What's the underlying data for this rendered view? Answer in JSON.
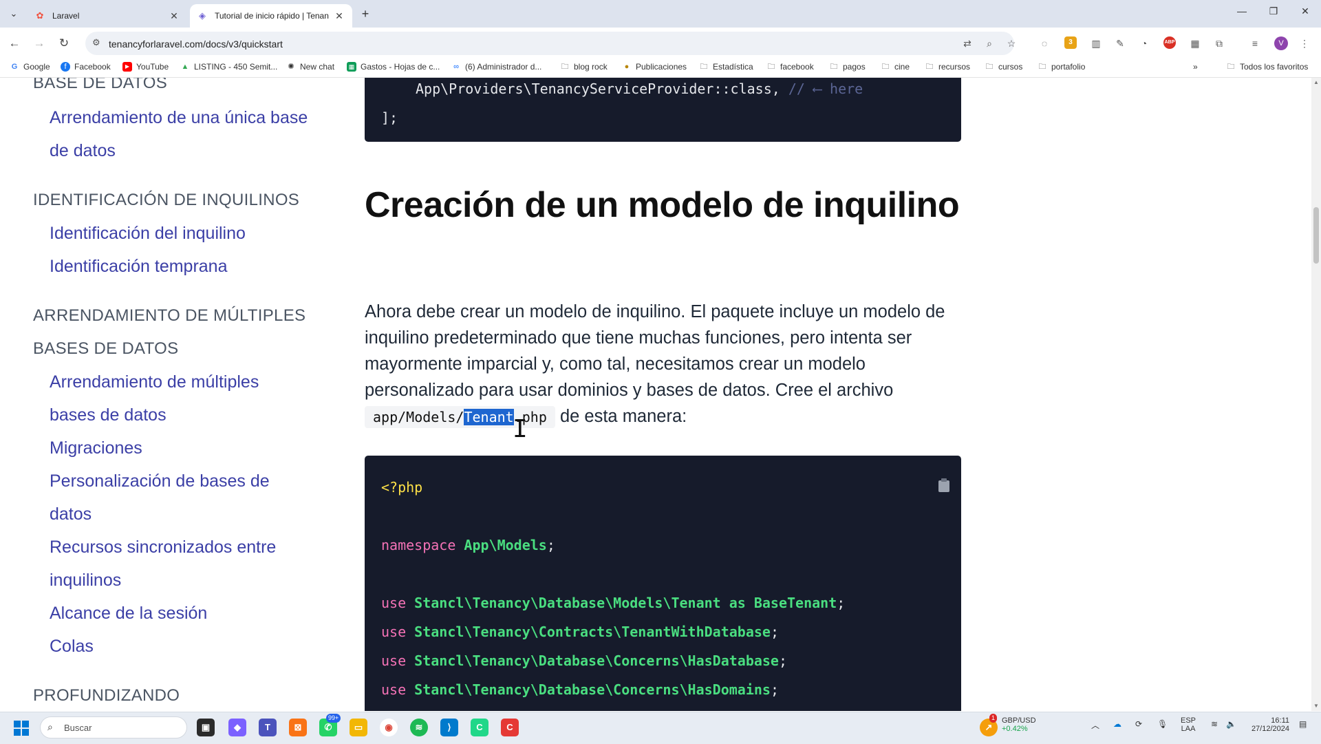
{
  "browser": {
    "tabs": [
      {
        "title": "Laravel",
        "active": false
      },
      {
        "title": "Tutorial de inicio rápido | Tenan",
        "active": true
      }
    ],
    "url": "tenancyforlaravel.com/docs/v3/quickstart",
    "avatar_letter": "V",
    "ext_badge": "3",
    "abp_label": "ABP"
  },
  "bookmarks": [
    {
      "label": "Google",
      "icon": "google-icon"
    },
    {
      "label": "Facebook",
      "icon": "facebook-icon"
    },
    {
      "label": "YouTube",
      "icon": "youtube-icon"
    },
    {
      "label": "LISTING - 450 Semit...",
      "icon": "drive-icon"
    },
    {
      "label": "New chat",
      "icon": "chatgpt-icon"
    },
    {
      "label": "Gastos - Hojas de c...",
      "icon": "sheets-icon"
    },
    {
      "label": "(6) Administrador d...",
      "icon": "meta-icon"
    },
    {
      "label": "blog rock",
      "icon": "folder-icon"
    },
    {
      "label": "Publicaciones",
      "icon": "folder-icon"
    },
    {
      "label": "Estadística",
      "icon": "folder-icon"
    },
    {
      "label": "facebook",
      "icon": "folder-icon"
    },
    {
      "label": "pagos",
      "icon": "folder-icon"
    },
    {
      "label": "cine",
      "icon": "folder-icon"
    },
    {
      "label": "recursos",
      "icon": "folder-icon"
    },
    {
      "label": "cursos",
      "icon": "folder-icon"
    },
    {
      "label": "portafolio",
      "icon": "folder-icon"
    }
  ],
  "bookmarks_all": "Todos los favoritos",
  "sidebar": {
    "sections": [
      {
        "title": "BASE DE DATOS"
      },
      {
        "title": "IDENTIFICACIÓN DE INQUILINOS"
      },
      {
        "title": "ARRENDAMIENTO DE MÚLTIPLES"
      },
      {
        "title": "BASES DE DATOS"
      },
      {
        "title": "PROFUNDIZANDO"
      }
    ],
    "links": [
      "Arrendamiento de una única base",
      "de datos",
      "Identificación del inquilino",
      "Identificación temprana",
      "Arrendamiento de múltiples",
      "bases de datos",
      "Migraciones",
      "Personalización de bases de",
      "datos",
      "Recursos sincronizados entre",
      "inquilinos",
      "Alcance de la sesión",
      "Colas"
    ]
  },
  "code_top": {
    "line1_code": "App\\Providers\\TenancyServiceProvider::class,",
    "line1_comment": " // ⟵ here",
    "line2": "];"
  },
  "heading": "Creación de un modelo de inquilino",
  "paragraph": {
    "text": "Ahora debe crear un modelo de inquilino. El paquete incluye un modelo de inquilino predeterminado que tiene muchas funciones, pero intenta ser mayormente imparcial y, como tal, necesitamos crear un modelo personalizado para usar dominios y bases de datos. Cree el archivo ",
    "code_before": "app/Models/",
    "code_selected": "Tenant",
    "code_after": ".php",
    "tail": " de esta manera:"
  },
  "code_main": {
    "open_tag": "<?php",
    "ns_keyword": "namespace",
    "ns_value": "App\\Models",
    "semicolon": ";",
    "use_keyword": "use",
    "uses": [
      "Stancl\\Tenancy\\Database\\Models\\Tenant as BaseTenant",
      "Stancl\\Tenancy\\Contracts\\TenantWithDatabase",
      "Stancl\\Tenancy\\Database\\Concerns\\HasDatabase",
      "Stancl\\Tenancy\\Database\\Concerns\\HasDomains"
    ]
  },
  "taskbar": {
    "search_placeholder": "Buscar",
    "whatsapp_badge": "99+",
    "stock_badge": "1",
    "stock_name": "GBP/USD",
    "stock_change": "+0.42%",
    "lang_top": "ESP",
    "lang_bottom": "LAA",
    "time": "16:11",
    "date": "27/12/2024"
  },
  "colors": {
    "link": "#3b3fa6",
    "code_bg": "#161b2b",
    "selection": "#1e66d0"
  }
}
